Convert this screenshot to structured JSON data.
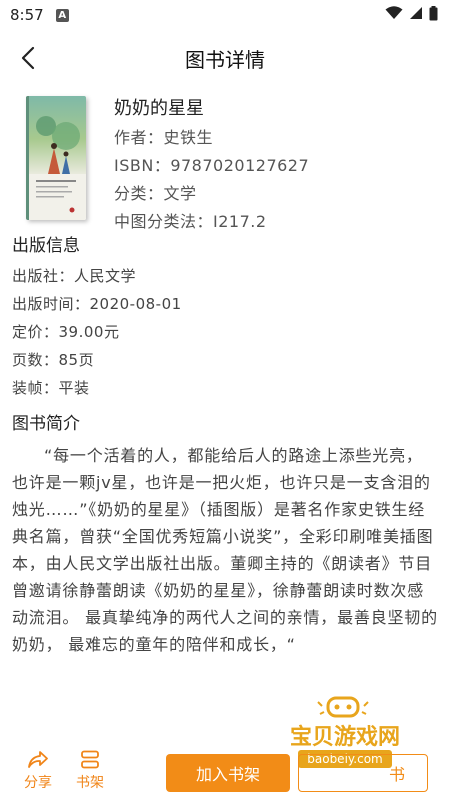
{
  "status_bar": {
    "time": "8:57",
    "app_icon_letter": "A",
    "icons": [
      "wifi-icon",
      "signal-icon",
      "battery-icon"
    ]
  },
  "header": {
    "title": "图书详情"
  },
  "book": {
    "name": "奶奶的星星",
    "author": "作者：史铁生",
    "isbn": "ISBN：9787020127627",
    "category": "分类：文学",
    "clc": "中图分类法：I217.2"
  },
  "publish": {
    "heading": "出版信息",
    "publisher": "出版社：人民文学",
    "date": "出版时间：2020-08-01",
    "price": "定价：39.00元",
    "pages": "页数：85页",
    "binding": "装帧：平装"
  },
  "intro": {
    "heading": "图书简介",
    "text": "“每一个活着的人，都能给后人的路途上添些光亮，也许是一颗jv星，也许是一把火炬，也许只是一支含泪的烛光……”《奶奶的星星》（插图版）是著名作家史铁生经典名篇，曾获“全国优秀短篇小说奖”，全彩印刷唯美插图本，由人民文学出版社出版。董卿主持的《朗读者》节目曾邀请徐静蕾朗读《奶奶的星星》，徐静蕾朗读时数次感动流泪。 最真挚纯净的两代人之间的亲情，最善良坚韧的奶奶， 最难忘的童年的陪伴和成长，“"
  },
  "bottom": {
    "share": "分享",
    "shelf": "书架",
    "add_to_shelf": "加入书架",
    "read_fragment": "书"
  },
  "watermark": {
    "line1": "宝贝游戏网",
    "line2": "baobeiy.com"
  },
  "colors": {
    "accent": "#f28c17",
    "watermark": "#e8a51c"
  }
}
